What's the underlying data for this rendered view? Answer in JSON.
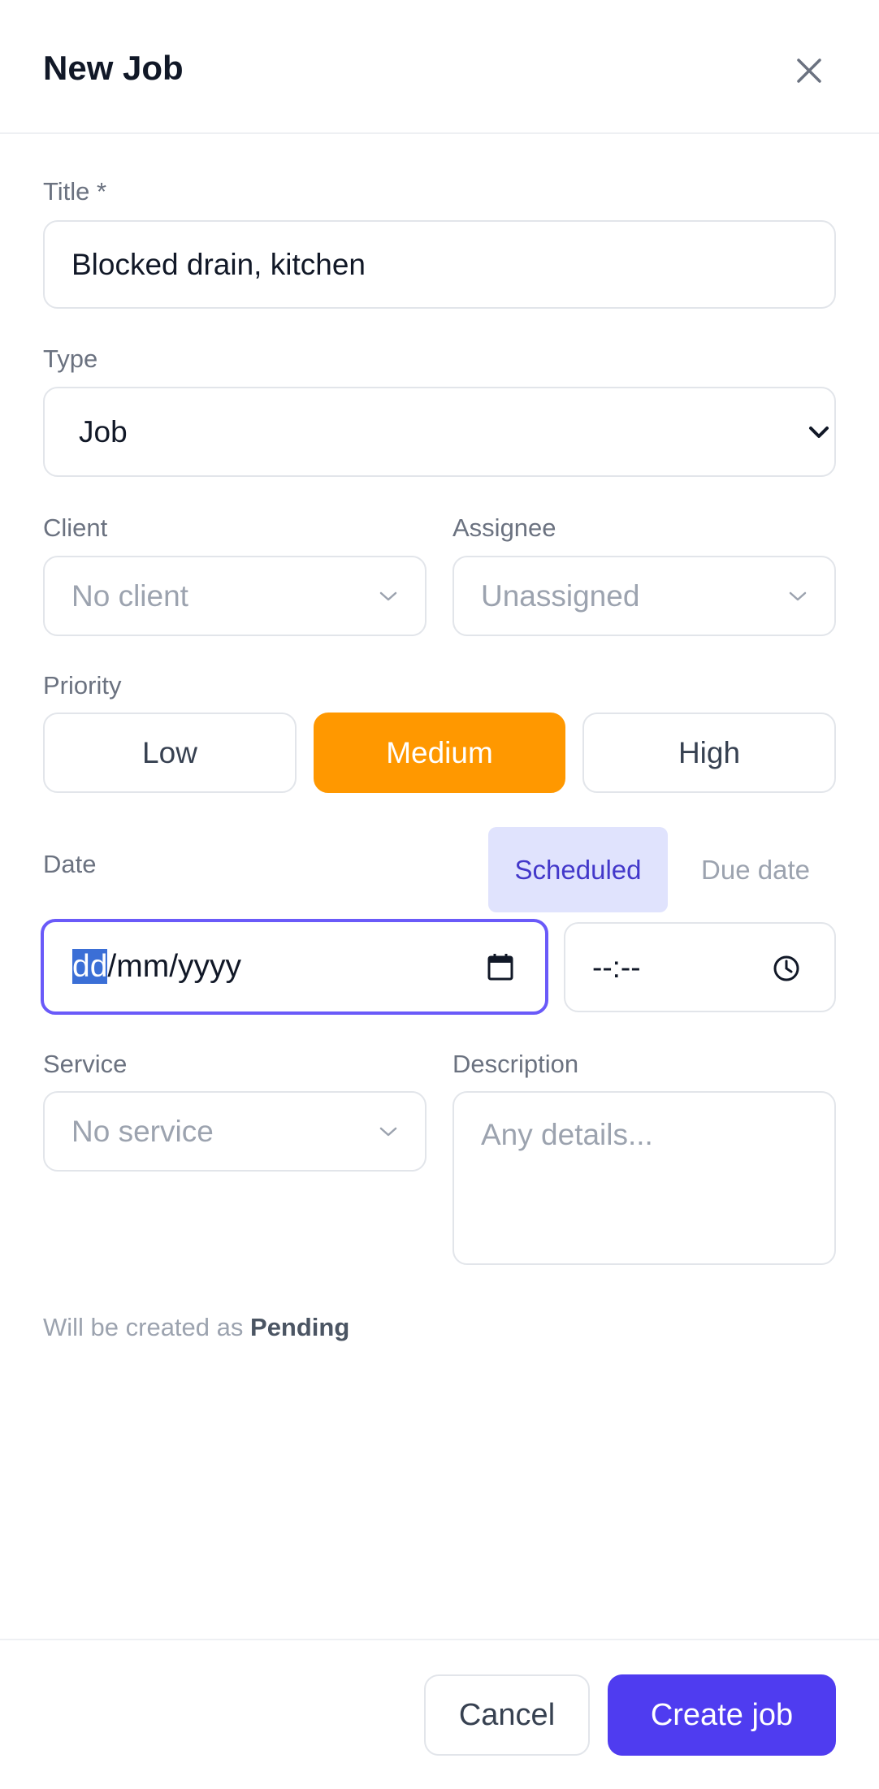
{
  "dialog": {
    "title": "New Job",
    "close_icon": "close-icon"
  },
  "form": {
    "title_label": "Title *",
    "title_value": "Blocked drain, kitchen",
    "type_label": "Type",
    "type_value": "Job",
    "client_label": "Client",
    "client_placeholder": "No client",
    "assignee_label": "Assignee",
    "assignee_placeholder": "Unassigned",
    "priority_label": "Priority",
    "priority_options": [
      "Low",
      "Medium",
      "High"
    ],
    "priority_selected": "Medium",
    "date_label": "Date",
    "date_tabs": [
      "Scheduled",
      "Due date"
    ],
    "date_tab_selected": "Scheduled",
    "date_placeholder_day": "dd",
    "date_placeholder_rest": "/mm/yyyy",
    "time_placeholder": "--:--",
    "service_label": "Service",
    "service_placeholder": "No service",
    "description_label": "Description",
    "description_placeholder": "Any details...",
    "status_note_prefix": "Will be created as",
    "status_note_value": "Pending"
  },
  "footer": {
    "cancel_label": "Cancel",
    "create_label": "Create job"
  },
  "colors": {
    "accent": "#4f3cf0",
    "priority_active": "#ff9800",
    "tab_active_bg": "#e0e3fd",
    "tab_active_text": "#4338ca",
    "focus_border": "#6a5af9"
  }
}
